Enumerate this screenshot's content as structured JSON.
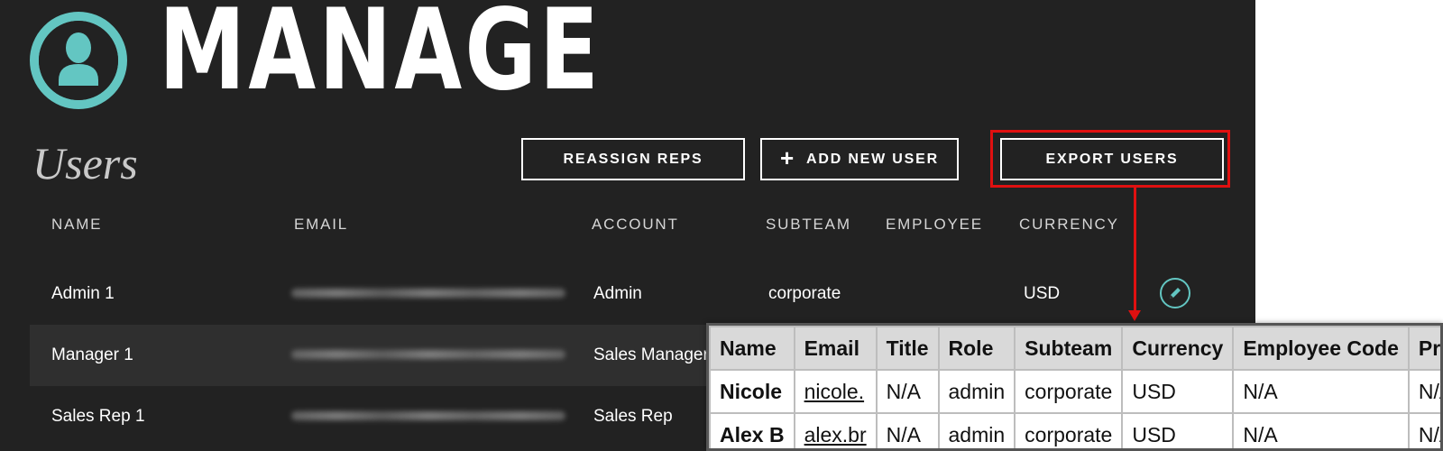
{
  "header": {
    "app_title": "MANAGE",
    "logo_icon": "user-avatar-icon",
    "accent_color": "#63c6c2"
  },
  "page": {
    "title": "Users"
  },
  "toolbar": {
    "reassign_label": "REASSIGN REPS",
    "add_user_label": "ADD NEW USER",
    "add_user_icon": "plus-icon",
    "export_label": "EXPORT USERS",
    "highlight_color": "#e01010"
  },
  "users_table": {
    "columns": [
      "NAME",
      "EMAIL",
      "ACCOUNT",
      "SUBTEAM",
      "EMPLOYEE",
      "CURRENCY"
    ],
    "rows": [
      {
        "name": "Admin 1",
        "account": "Admin",
        "subteam": "corporate",
        "employee": "",
        "currency": "USD"
      },
      {
        "name": "Manager 1",
        "account": "Sales Manager",
        "subteam": "",
        "employee": "",
        "currency": ""
      },
      {
        "name": "Sales Rep 1",
        "account": "Sales Rep",
        "subteam": "",
        "employee": "",
        "currency": ""
      }
    ],
    "edit_icon": "pencil-icon"
  },
  "export_preview": {
    "columns": [
      "Name",
      "Email",
      "Title",
      "Role",
      "Subteam",
      "Currency",
      "Employee Code",
      "Pri"
    ],
    "rows": [
      [
        "Nicole",
        "nicole.",
        "N/A",
        "admin",
        "corporate",
        "USD",
        "N/A",
        "N/A"
      ],
      [
        "Alex B",
        "alex.br",
        "N/A",
        "admin",
        "corporate",
        "USD",
        "N/A",
        "N/A"
      ]
    ]
  }
}
